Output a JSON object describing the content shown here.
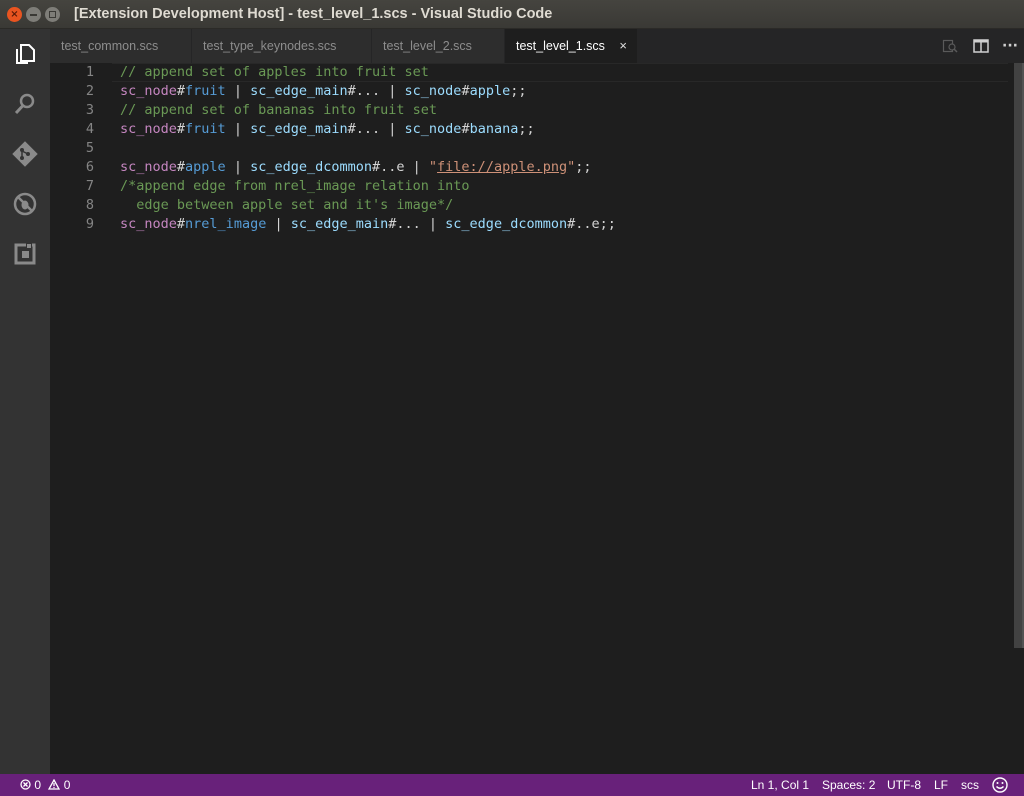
{
  "window": {
    "title": "[Extension Development Host] - test_level_1.scs - Visual Studio Code"
  },
  "activity_bar": {
    "items": [
      {
        "name": "explorer",
        "icon": "files-icon"
      },
      {
        "name": "search",
        "icon": "search-icon"
      },
      {
        "name": "source-control",
        "icon": "git-icon"
      },
      {
        "name": "debug",
        "icon": "debug-icon"
      },
      {
        "name": "extensions",
        "icon": "extensions-icon"
      }
    ]
  },
  "tabs": [
    {
      "label": "test_common.scs",
      "active": false
    },
    {
      "label": "test_type_keynodes.scs",
      "active": false
    },
    {
      "label": "test_level_2.scs",
      "active": false
    },
    {
      "label": "test_level_1.scs",
      "active": true,
      "close": "×"
    }
  ],
  "tab_actions": {
    "items": [
      "open-changes-icon",
      "split-editor-icon",
      "more-icon"
    ],
    "more_glyph": "···"
  },
  "editor": {
    "lines": [
      {
        "num": "1",
        "tokens": [
          {
            "t": "comment",
            "v": "// append set of apples into fruit set"
          }
        ]
      },
      {
        "num": "2",
        "tokens": [
          {
            "t": "node",
            "v": "sc_node"
          },
          {
            "t": "hash",
            "v": "#"
          },
          {
            "t": "id",
            "v": "fruit"
          },
          {
            "t": "op",
            "v": " | "
          },
          {
            "t": "edge",
            "v": "sc_edge_main"
          },
          {
            "t": "hash",
            "v": "#..."
          },
          {
            "t": "op",
            "v": " | "
          },
          {
            "t": "edge",
            "v": "sc_node"
          },
          {
            "t": "hash",
            "v": "#"
          },
          {
            "t": "edge",
            "v": "apple"
          },
          {
            "t": "semi",
            "v": ";;"
          }
        ]
      },
      {
        "num": "3",
        "tokens": [
          {
            "t": "comment",
            "v": "// append set of bananas into fruit set"
          }
        ]
      },
      {
        "num": "4",
        "tokens": [
          {
            "t": "node",
            "v": "sc_node"
          },
          {
            "t": "hash",
            "v": "#"
          },
          {
            "t": "id",
            "v": "fruit"
          },
          {
            "t": "op",
            "v": " | "
          },
          {
            "t": "edge",
            "v": "sc_edge_main"
          },
          {
            "t": "hash",
            "v": "#..."
          },
          {
            "t": "op",
            "v": " | "
          },
          {
            "t": "edge",
            "v": "sc_node"
          },
          {
            "t": "hash",
            "v": "#"
          },
          {
            "t": "edge",
            "v": "banana"
          },
          {
            "t": "semi",
            "v": ";;"
          }
        ]
      },
      {
        "num": "5",
        "tokens": []
      },
      {
        "num": "6",
        "tokens": [
          {
            "t": "node",
            "v": "sc_node"
          },
          {
            "t": "hash",
            "v": "#"
          },
          {
            "t": "id",
            "v": "apple"
          },
          {
            "t": "op",
            "v": " | "
          },
          {
            "t": "edge",
            "v": "sc_edge_dcommon"
          },
          {
            "t": "hash",
            "v": "#..e"
          },
          {
            "t": "op",
            "v": " | "
          },
          {
            "t": "str",
            "v": "\""
          },
          {
            "t": "link",
            "v": "file://apple.png"
          },
          {
            "t": "str",
            "v": "\""
          },
          {
            "t": "semi",
            "v": ";;"
          }
        ]
      },
      {
        "num": "7",
        "tokens": [
          {
            "t": "comment",
            "v": "/*append edge from nrel_image relation into"
          }
        ]
      },
      {
        "num": "8",
        "tokens": [
          {
            "t": "comment",
            "v": "  edge between apple set and it's image*/"
          }
        ]
      },
      {
        "num": "9",
        "tokens": [
          {
            "t": "node",
            "v": "sc_node"
          },
          {
            "t": "hash",
            "v": "#"
          },
          {
            "t": "id",
            "v": "nrel_image"
          },
          {
            "t": "op",
            "v": " | "
          },
          {
            "t": "edge",
            "v": "sc_edge_main"
          },
          {
            "t": "hash",
            "v": "#..."
          },
          {
            "t": "op",
            "v": " | "
          },
          {
            "t": "edge",
            "v": "sc_edge_dcommon"
          },
          {
            "t": "hash",
            "v": "#..e"
          },
          {
            "t": "semi",
            "v": ";;"
          }
        ]
      }
    ]
  },
  "status_bar": {
    "errors": "0",
    "warnings": "0",
    "position": "Ln 1, Col 1",
    "indent": "Spaces: 2",
    "encoding": "UTF-8",
    "eol": "LF",
    "language": "scs",
    "feedback_icon": "smiley-icon",
    "color": "#68217a"
  }
}
